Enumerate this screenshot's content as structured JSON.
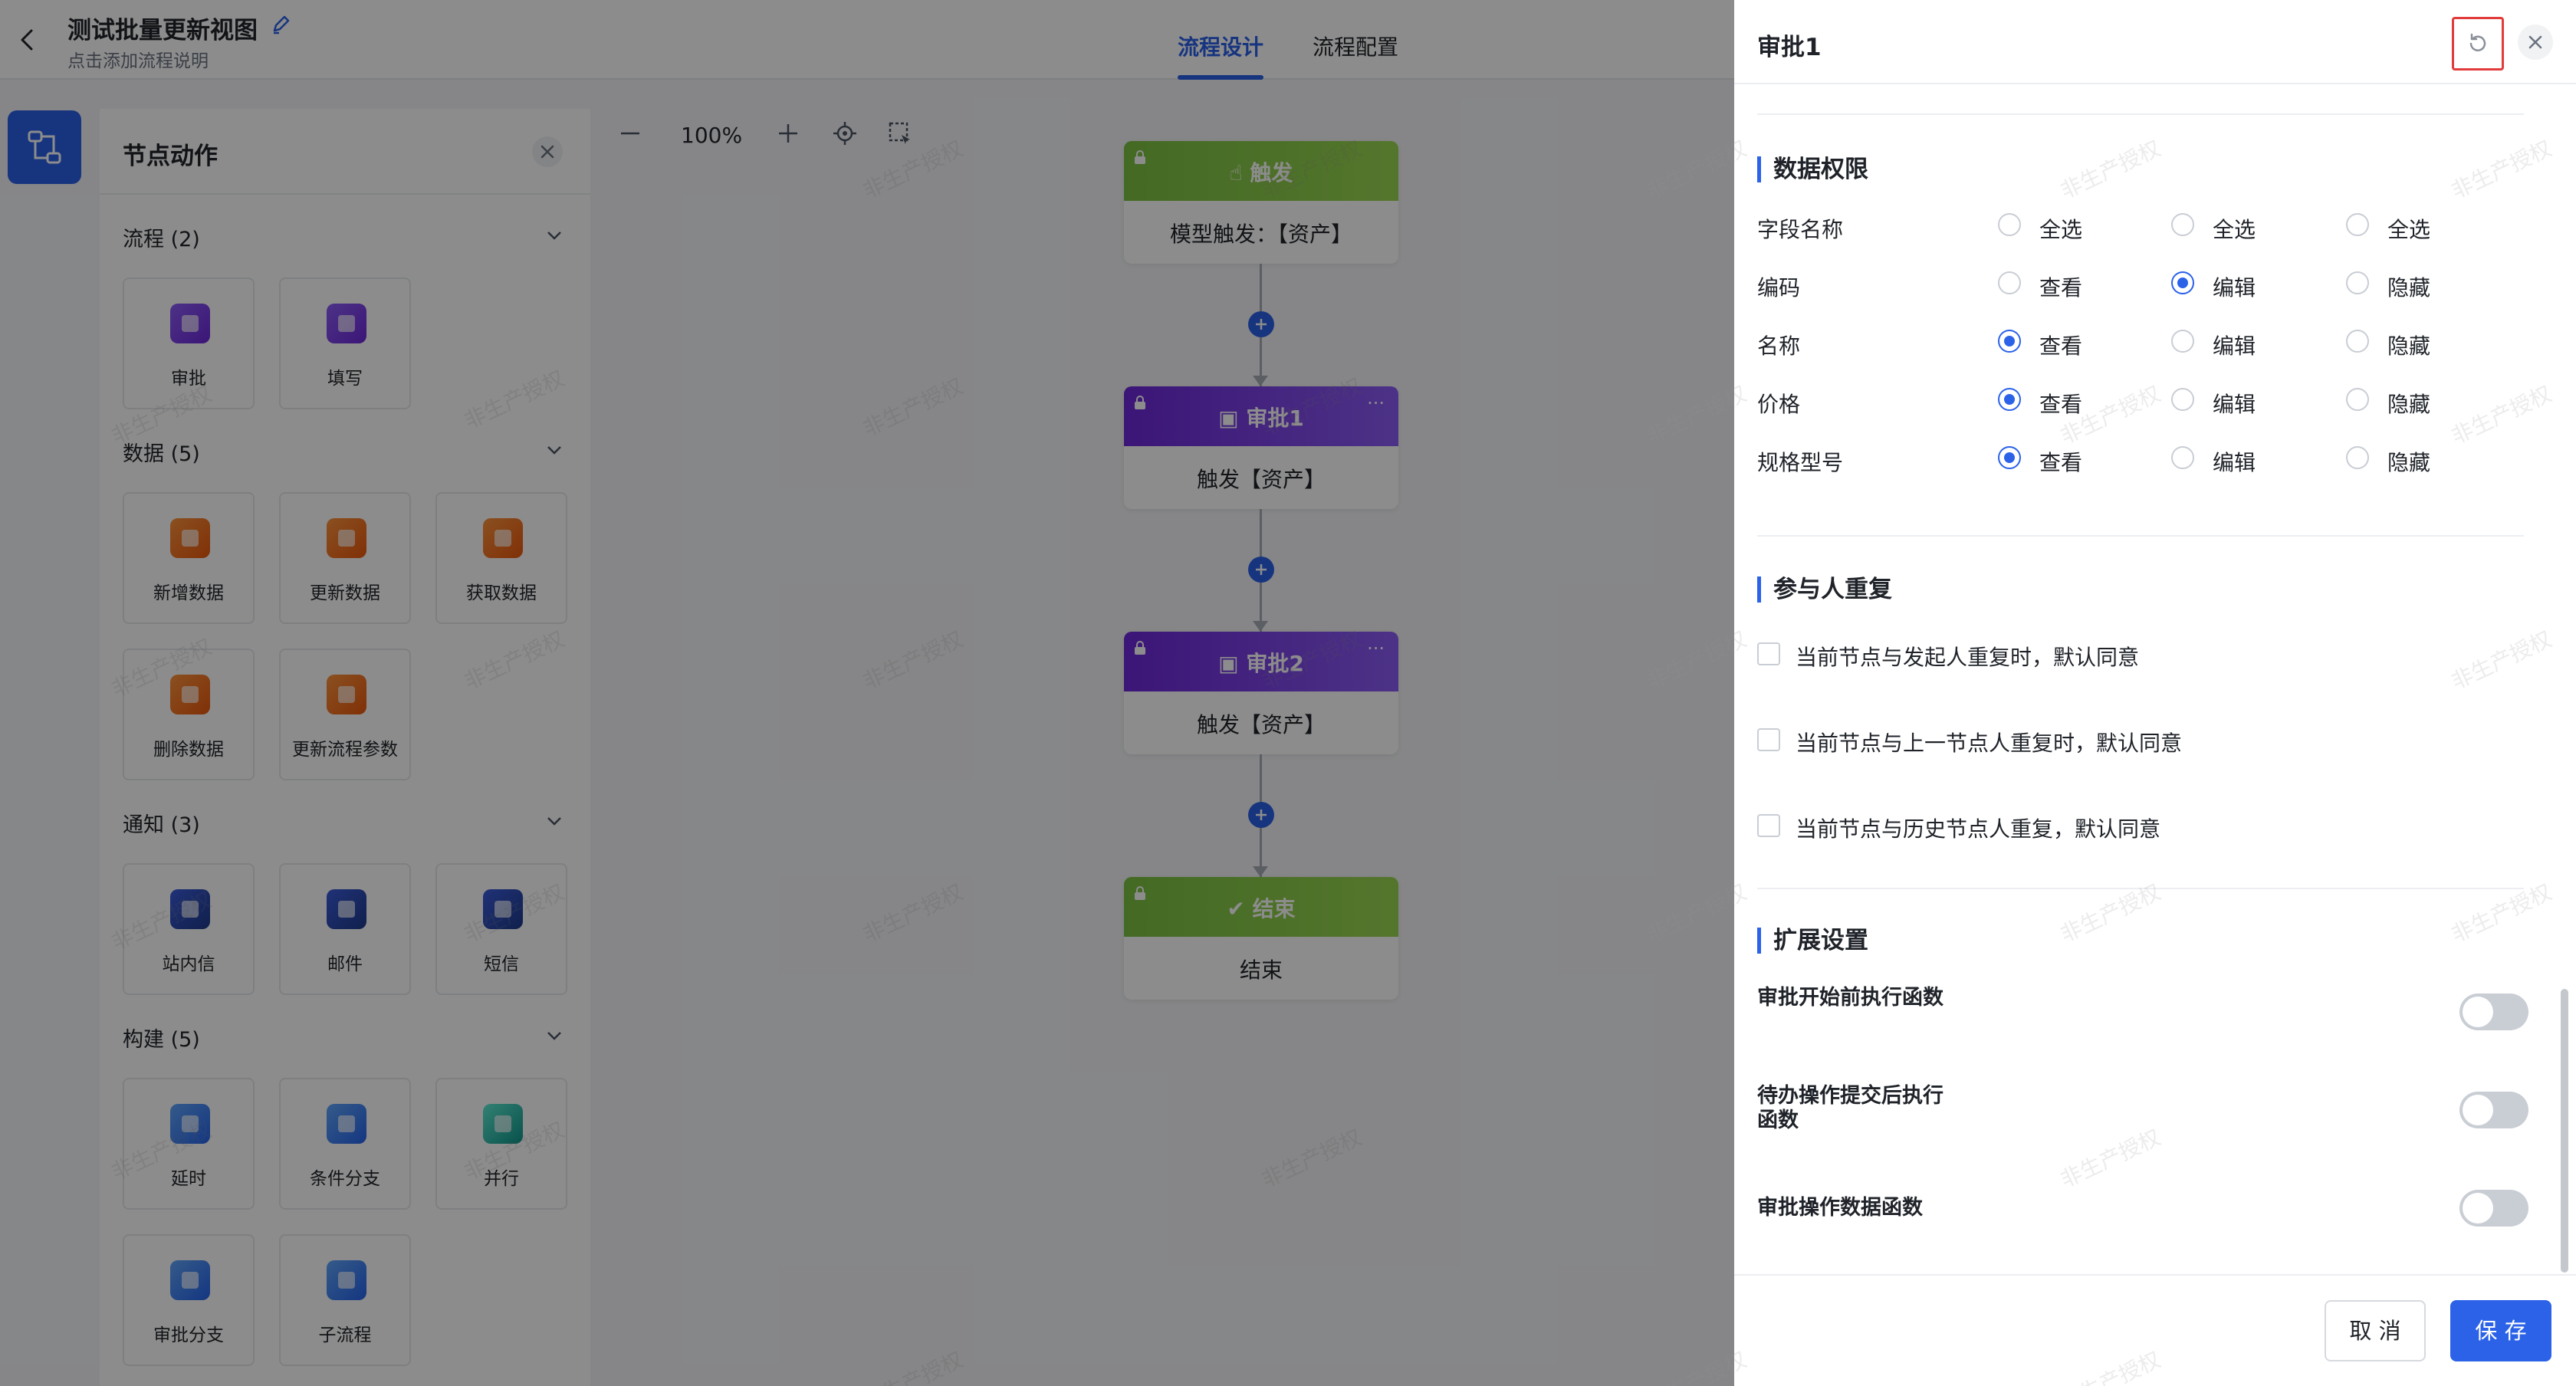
{
  "header": {
    "title": "测试批量更新视图",
    "subtitle": "点击添加流程说明",
    "tabs": [
      {
        "label": "流程设计",
        "active": true
      },
      {
        "label": "流程配置",
        "active": false
      }
    ]
  },
  "palette": {
    "title": "节点动作",
    "groups": [
      {
        "label": "流程 (2)",
        "items": [
          "审批",
          "填写"
        ]
      },
      {
        "label": "数据 (5)",
        "items": [
          "新增数据",
          "更新数据",
          "获取数据",
          "删除数据",
          "更新流程参数"
        ]
      },
      {
        "label": "通知 (3)",
        "items": [
          "站内信",
          "邮件",
          "短信"
        ]
      },
      {
        "label": "构建 (5)",
        "items": [
          "延时",
          "条件分支",
          "并行",
          "审批分支",
          "子流程"
        ]
      }
    ]
  },
  "toolbar": {
    "zoom": "100%"
  },
  "flow": {
    "nodes": [
      {
        "title": "触发",
        "body": "模型触发：【资产】"
      },
      {
        "title": "审批1",
        "body": "触发【资产】",
        "more": "···"
      },
      {
        "title": "审批2",
        "body": "触发【资产】",
        "more": "···"
      },
      {
        "title": "结束",
        "body": "结束"
      }
    ]
  },
  "watermark": "非生产授权",
  "drawer": {
    "title": "审批1",
    "data_permission": {
      "title": "数据权限",
      "header_label": "字段名称",
      "select_all": [
        "全选",
        "全选",
        "全选"
      ],
      "options": [
        "查看",
        "编辑",
        "隐藏"
      ],
      "rows": [
        {
          "label": "编码",
          "selected": "编辑"
        },
        {
          "label": "名称",
          "selected": "查看"
        },
        {
          "label": "价格",
          "selected": "查看"
        },
        {
          "label": "规格型号",
          "selected": "查看"
        }
      ]
    },
    "participant_repeat": {
      "title": "参与人重复",
      "items": [
        "当前节点与发起人重复时，默认同意",
        "当前节点与上一节点人重复时，默认同意",
        "当前节点与历史节点人重复，默认同意"
      ]
    },
    "extension": {
      "title": "扩展设置",
      "items": [
        {
          "label": "审批开始前执行函数",
          "enabled": false
        },
        {
          "label": "待办操作提交后执行函数",
          "enabled": false
        },
        {
          "label": "审批操作数据函数",
          "enabled": false
        }
      ]
    },
    "buttons": {
      "cancel": "取 消",
      "save": "保 存"
    }
  },
  "colors": {
    "accent": "#2b62e8",
    "trigger_green": "#8ccd4a",
    "approval_purple": "#7c3aed",
    "highlight_red": "#e23b3b"
  }
}
